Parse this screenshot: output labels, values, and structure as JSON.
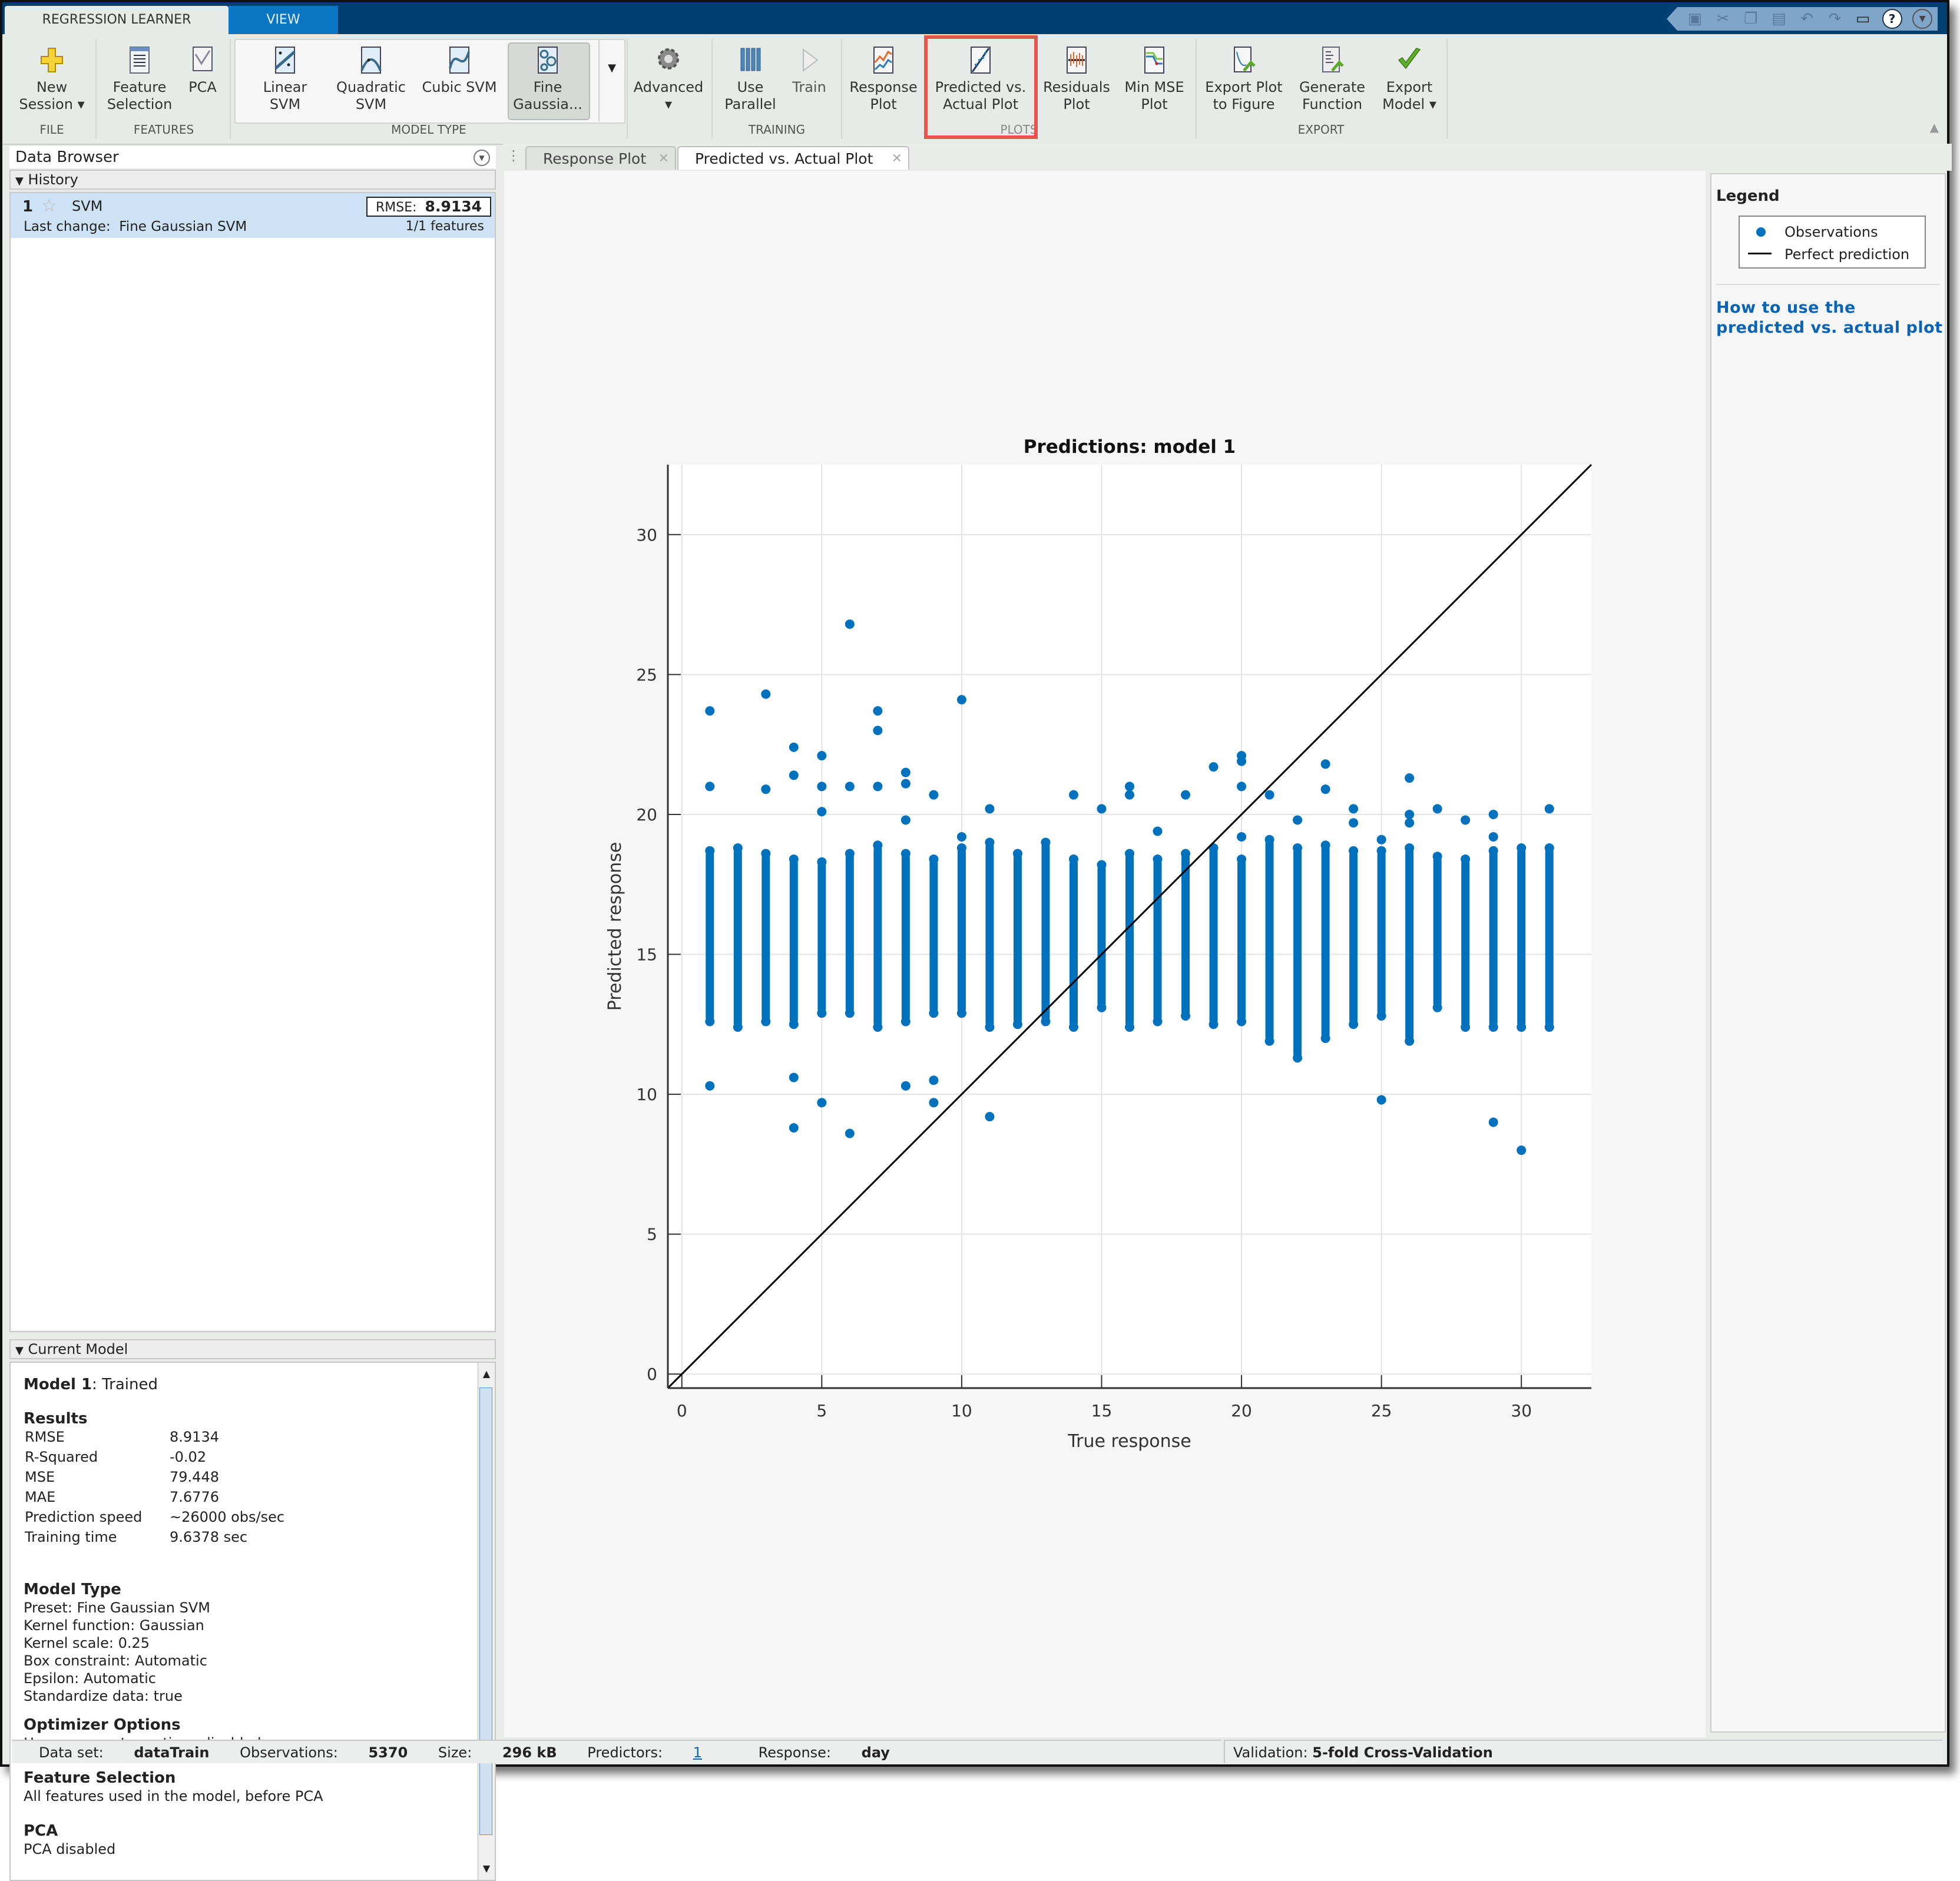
{
  "app": {
    "tabs": [
      {
        "label": "REGRESSION LEARNER",
        "active": true
      },
      {
        "label": "VIEW",
        "active": false
      }
    ],
    "quick_access": [
      "save-icon",
      "cut-icon",
      "copy-icon",
      "paste-icon",
      "undo-icon",
      "redo-icon",
      "window-layout-icon",
      "help-icon",
      "options-icon"
    ]
  },
  "ribbon": {
    "buttons": {
      "new_session": "New\nSession ▾",
      "feature_selection": "Feature\nSelection",
      "pca": "PCA",
      "linear_svm": "Linear\nSVM",
      "quadratic_svm": "Quadratic\nSVM",
      "cubic_svm": "Cubic SVM",
      "fine_gaussian": "Fine\nGaussia...",
      "advanced": "Advanced\n▾",
      "use_parallel": "Use\nParallel",
      "train": "Train",
      "response_plot": "Response\nPlot",
      "predicted_actual": "Predicted vs.\nActual Plot",
      "residuals_plot": "Residuals\nPlot",
      "min_mse_plot": "Min MSE\nPlot",
      "export_plot": "Export Plot\nto Figure",
      "generate_function": "Generate\nFunction",
      "export_model": "Export\nModel ▾"
    },
    "groups": {
      "file": "FILE",
      "features": "FEATURES",
      "model_type": "MODEL TYPE",
      "training": "TRAINING",
      "plots": "PLOTS",
      "export": "EXPORT"
    }
  },
  "data_browser": {
    "title": "Data Browser",
    "history_label": "History",
    "history": [
      {
        "num": "1",
        "name": "SVM",
        "rmse_label": "RMSE:",
        "rmse": "8.9134",
        "last_change_label": "Last change:",
        "last_change": "Fine Gaussian SVM",
        "features": "1/1 features"
      }
    ],
    "current_model_label": "Current Model"
  },
  "current_model": {
    "title_bold": "Model 1",
    "title_rest": ": Trained",
    "results_heading": "Results",
    "results": [
      {
        "key": "RMSE",
        "value": "8.9134"
      },
      {
        "key": "R-Squared",
        "value": "-0.02"
      },
      {
        "key": "MSE",
        "value": "79.448"
      },
      {
        "key": "MAE",
        "value": "7.6776"
      },
      {
        "key": "Prediction speed",
        "value": "~26000 obs/sec"
      },
      {
        "key": "Training time",
        "value": "9.6378 sec"
      }
    ],
    "model_type_heading": "Model Type",
    "model_type": [
      "Preset: Fine Gaussian SVM",
      "Kernel function: Gaussian",
      "Kernel scale: 0.25",
      "Box constraint: Automatic",
      "Epsilon: Automatic",
      "Standardize data: true"
    ],
    "optimizer_heading": "Optimizer Options",
    "optimizer": "Hyperparameter options disabled",
    "feature_sel_heading": "Feature Selection",
    "feature_sel": "All features used in the model, before PCA",
    "pca_heading": "PCA",
    "pca": "PCA disabled"
  },
  "doc_tabs": [
    {
      "label": "Response Plot",
      "active": false
    },
    {
      "label": "Predicted vs. Actual Plot",
      "active": true
    }
  ],
  "legend_panel": {
    "title": "Legend",
    "entries": [
      "Observations",
      "Perfect prediction"
    ],
    "help_link": "How to use the predicted vs. actual plot"
  },
  "status": {
    "dataset_label": "Data set:",
    "dataset": "dataTrain",
    "obs_label": "Observations:",
    "obs": "5370",
    "size_label": "Size:",
    "size": "296 kB",
    "pred_label": "Predictors:",
    "pred": "1",
    "resp_label": "Response:",
    "resp": "day",
    "validation_label": "Validation:",
    "validation": "5-fold Cross-Validation"
  },
  "colors": {
    "accent": "#0072bd",
    "titlebar": "#003f72",
    "view_tab": "#0a75c2",
    "highlight": "#e8534a",
    "link": "#0a64b4"
  },
  "chart_data": {
    "type": "scatter",
    "title": "Predictions: model 1",
    "xlabel": "True response",
    "ylabel": "Predicted response",
    "xlim": [
      -0.5,
      32.5
    ],
    "ylim": [
      -0.5,
      32.5
    ],
    "xticks": [
      0,
      5,
      10,
      15,
      20,
      25,
      30
    ],
    "yticks": [
      0,
      5,
      10,
      15,
      20,
      25,
      30
    ],
    "grid": true,
    "legend": [
      "Observations",
      "Perfect prediction"
    ],
    "reference_line": {
      "name": "Perfect prediction",
      "from": [
        -0.5,
        -0.5
      ],
      "to": [
        32.5,
        32.5
      ]
    },
    "series": [
      {
        "name": "Observations",
        "columns": [
          {
            "x": 1,
            "low": 12.6,
            "high": 18.7,
            "outliers": [
              23.7,
              21.0,
              10.3
            ]
          },
          {
            "x": 2,
            "low": 12.4,
            "high": 18.8,
            "outliers": []
          },
          {
            "x": 3,
            "low": 12.6,
            "high": 18.6,
            "outliers": [
              24.3,
              20.9
            ]
          },
          {
            "x": 4,
            "low": 12.5,
            "high": 18.4,
            "outliers": [
              22.4,
              21.4,
              10.6,
              8.8
            ]
          },
          {
            "x": 5,
            "low": 12.9,
            "high": 18.3,
            "outliers": [
              22.1,
              21.0,
              20.1,
              9.7
            ]
          },
          {
            "x": 6,
            "low": 12.9,
            "high": 18.6,
            "outliers": [
              26.8,
              21.0,
              8.6
            ]
          },
          {
            "x": 7,
            "low": 12.4,
            "high": 18.9,
            "outliers": [
              23.7,
              23.0,
              21.0
            ]
          },
          {
            "x": 8,
            "low": 12.6,
            "high": 18.6,
            "outliers": [
              21.5,
              21.1,
              19.8,
              10.3
            ]
          },
          {
            "x": 9,
            "low": 12.9,
            "high": 18.4,
            "outliers": [
              20.7,
              10.5,
              9.7
            ]
          },
          {
            "x": 10,
            "low": 12.9,
            "high": 18.8,
            "outliers": [
              24.1,
              19.2
            ]
          },
          {
            "x": 11,
            "low": 12.4,
            "high": 19.0,
            "outliers": [
              20.2,
              9.2
            ]
          },
          {
            "x": 12,
            "low": 12.5,
            "high": 18.6,
            "outliers": []
          },
          {
            "x": 13,
            "low": 12.6,
            "high": 19.0,
            "outliers": []
          },
          {
            "x": 14,
            "low": 12.4,
            "high": 18.4,
            "outliers": [
              20.7
            ]
          },
          {
            "x": 15,
            "low": 13.1,
            "high": 18.2,
            "outliers": [
              20.2
            ]
          },
          {
            "x": 16,
            "low": 12.4,
            "high": 18.6,
            "outliers": [
              21.0,
              20.7
            ]
          },
          {
            "x": 17,
            "low": 12.6,
            "high": 18.4,
            "outliers": [
              19.4
            ]
          },
          {
            "x": 18,
            "low": 12.8,
            "high": 18.6,
            "outliers": [
              20.7
            ]
          },
          {
            "x": 19,
            "low": 12.5,
            "high": 18.8,
            "outliers": [
              21.7
            ]
          },
          {
            "x": 20,
            "low": 12.6,
            "high": 18.4,
            "outliers": [
              22.1,
              21.9,
              21.0,
              19.2
            ]
          },
          {
            "x": 21,
            "low": 11.9,
            "high": 19.1,
            "outliers": [
              20.7
            ]
          },
          {
            "x": 22,
            "low": 11.3,
            "high": 18.8,
            "outliers": [
              19.8
            ]
          },
          {
            "x": 23,
            "low": 12.0,
            "high": 18.9,
            "outliers": [
              21.8,
              20.9
            ]
          },
          {
            "x": 24,
            "low": 12.5,
            "high": 18.7,
            "outliers": [
              20.2,
              19.7
            ]
          },
          {
            "x": 25,
            "low": 12.8,
            "high": 18.7,
            "outliers": [
              19.1,
              9.8
            ]
          },
          {
            "x": 26,
            "low": 11.9,
            "high": 18.8,
            "outliers": [
              21.3,
              20.0,
              19.7
            ]
          },
          {
            "x": 27,
            "low": 13.1,
            "high": 18.5,
            "outliers": [
              20.2
            ]
          },
          {
            "x": 28,
            "low": 12.4,
            "high": 18.4,
            "outliers": [
              19.8
            ]
          },
          {
            "x": 29,
            "low": 12.4,
            "high": 18.7,
            "outliers": [
              20.0,
              19.2,
              9.0
            ]
          },
          {
            "x": 30,
            "low": 12.4,
            "high": 18.8,
            "outliers": [
              8.0
            ]
          },
          {
            "x": 31,
            "low": 12.4,
            "high": 18.8,
            "outliers": [
              20.2
            ]
          }
        ]
      }
    ]
  }
}
